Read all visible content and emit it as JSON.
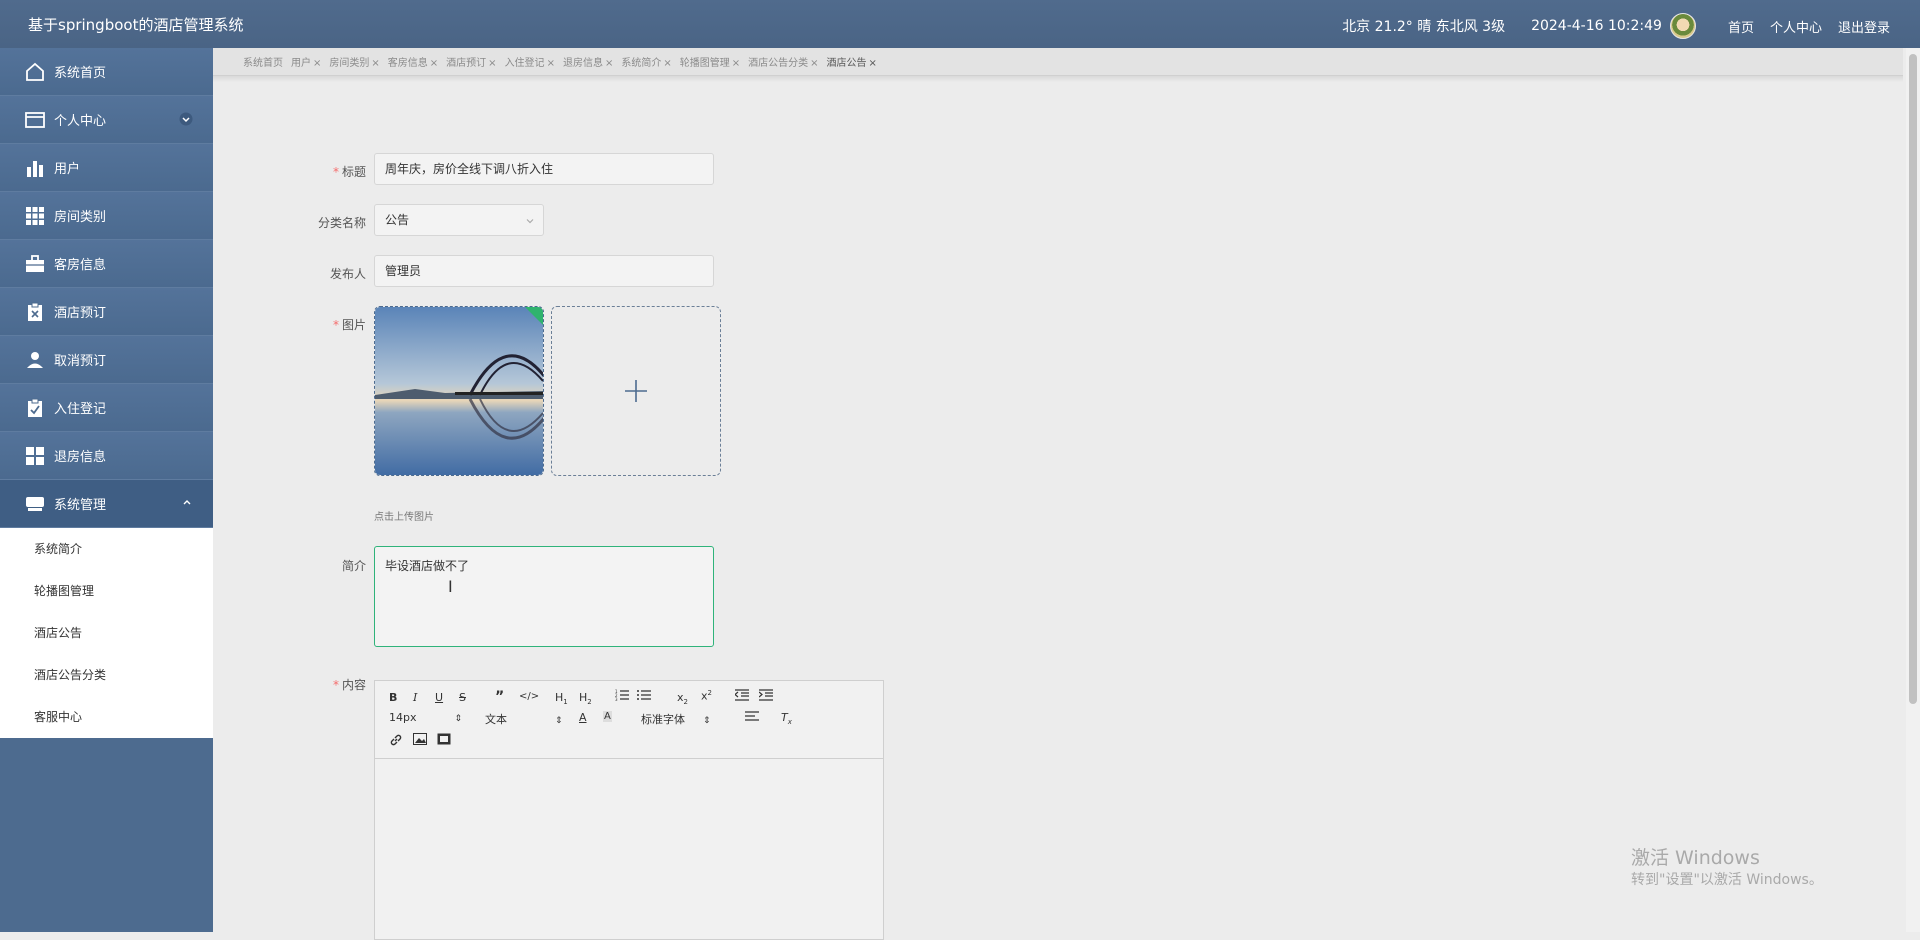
{
  "header": {
    "title": "基于springboot的酒店管理系统",
    "weather": "北京  21.2°  晴  东北风  3级",
    "datetime": "2024-4-16 10:2:49",
    "links": [
      "首页",
      "个人中心",
      "退出登录"
    ]
  },
  "sidebar": {
    "items": [
      {
        "label": "系统首页",
        "icon": "home-icon"
      },
      {
        "label": "个人中心",
        "icon": "wallet-icon"
      },
      {
        "label": "用户",
        "icon": "bar-chart-icon"
      },
      {
        "label": "房间类别",
        "icon": "grid-icon"
      },
      {
        "label": "客房信息",
        "icon": "briefcase-icon"
      },
      {
        "label": "酒店预订",
        "icon": "clipboard-x-icon"
      },
      {
        "label": "取消预订",
        "icon": "user-icon"
      },
      {
        "label": "入住登记",
        "icon": "clipboard-check-icon"
      },
      {
        "label": "退房信息",
        "icon": "dashboard-icon"
      },
      {
        "label": "系统管理",
        "icon": "drive-icon"
      }
    ],
    "submenu": [
      "系统简介",
      "轮播图管理",
      "酒店公告",
      "酒店公告分类",
      "客服中心"
    ]
  },
  "tabs": [
    "系统首页",
    "用户",
    "房间类别",
    "客房信息",
    "酒店预订",
    "入住登记",
    "退房信息",
    "系统简介",
    "轮播图管理",
    "酒店公告分类",
    "酒店公告"
  ],
  "form": {
    "title_label": "标题",
    "title_value": "周年庆，房价全线下调八折入住",
    "category_label": "分类名称",
    "category_value": "公告",
    "publisher_label": "发布人",
    "publisher_value": "管理员",
    "image_label": "图片",
    "upload_hint": "点击上传图片",
    "intro_label": "简介",
    "intro_value": "毕设酒店做不了",
    "content_label": "内容"
  },
  "editor": {
    "font_size": "14px",
    "block_format": "文本",
    "font_family": "标准字体"
  },
  "watermark": {
    "line1": "激活 Windows",
    "line2": "转到\"设置\"以激活 Windows。"
  },
  "colors": {
    "header_bg": "#4f6a8c",
    "sidebar_bg": "#4d6b8f",
    "required": "#f56c6c",
    "focus_border": "#2fb37a"
  }
}
